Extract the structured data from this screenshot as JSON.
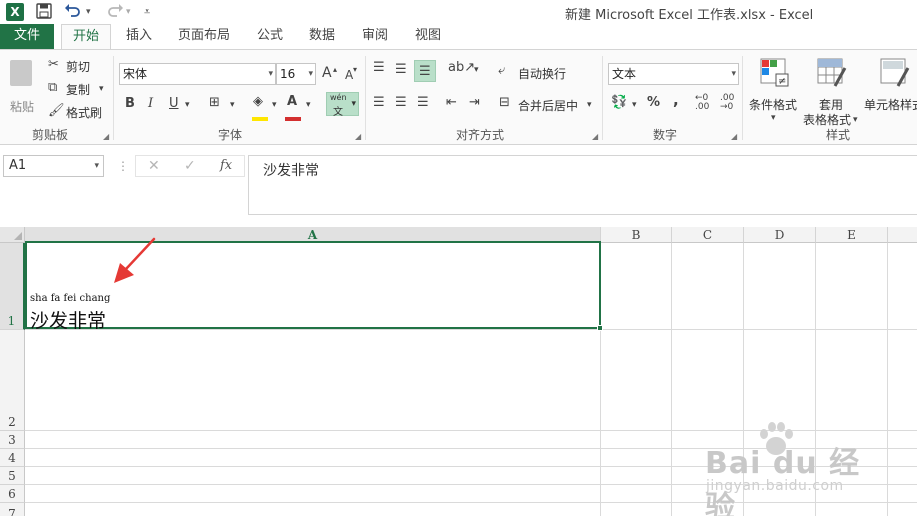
{
  "window": {
    "title": "新建 Microsoft Excel 工作表.xlsx - Excel",
    "app_logo": "X"
  },
  "quick_access": {
    "save_icon": "save-icon",
    "undo_icon": "undo-icon",
    "redo_icon": "redo-icon",
    "customize_icon": "customize-icon"
  },
  "tabs": [
    {
      "label": "文件"
    },
    {
      "label": "开始"
    },
    {
      "label": "插入"
    },
    {
      "label": "页面布局"
    },
    {
      "label": "公式"
    },
    {
      "label": "数据"
    },
    {
      "label": "审阅"
    },
    {
      "label": "视图"
    }
  ],
  "ribbon": {
    "clipboard": {
      "paste": "粘贴",
      "cut": "剪切",
      "copy": "复制",
      "format_painter": "格式刷",
      "label": "剪贴板"
    },
    "font": {
      "name": "宋体",
      "size": "16",
      "bold": "B",
      "italic": "I",
      "underline": "U",
      "grow": "A",
      "shrink": "A",
      "phonetic_top": "wén",
      "phonetic_bottom": "文",
      "font_color_letter": "A",
      "label": "字体"
    },
    "alignment": {
      "wrap_text": "自动换行",
      "merge_center": "合并后居中",
      "label": "对齐方式"
    },
    "number": {
      "format": "文本",
      "percent": "%",
      "comma": ",",
      "label": "数字"
    },
    "styles": {
      "conditional": "条件格式",
      "table_line1": "套用",
      "table_line2": "表格格式",
      "cell_styles": "单元格样式",
      "label": "样式"
    }
  },
  "formula_bar": {
    "name_box": "A1",
    "cancel": "✕",
    "enter": "✓",
    "fx": "fx",
    "value": "沙发非常"
  },
  "grid": {
    "columns": [
      "A",
      "B",
      "C",
      "D",
      "E"
    ],
    "rows": [
      "1",
      "2",
      "3",
      "4",
      "5",
      "6",
      "7"
    ],
    "selected_cell": "A1",
    "a1_phonetic": "sha fa fei chang",
    "a1_text": "沙发非常"
  },
  "watermark": {
    "brand": "Bai du 经验",
    "url": "jingyan.baidu.com"
  },
  "colors": {
    "excel_green": "#217346",
    "arrow_red": "#e53935",
    "font_color_bar": "#d32f2f",
    "highlight_bar": "#ffe600"
  }
}
